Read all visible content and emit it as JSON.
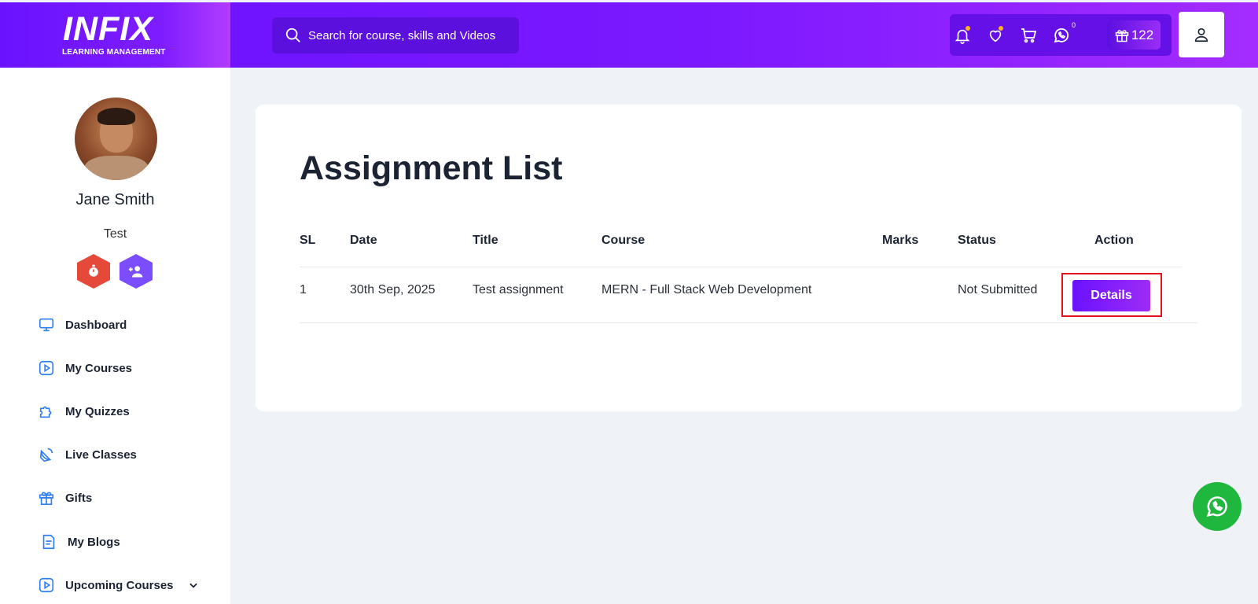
{
  "brand": {
    "logo": "INFIX",
    "tagline": "LEARNING MANAGEMENT"
  },
  "search": {
    "placeholder": "Search for course, skills and Videos"
  },
  "header_tools": {
    "whatsapp_count": "0",
    "points": "122",
    "icons": [
      "bell-icon",
      "heart-icon",
      "cart-icon",
      "whatsapp-icon",
      "gift-icon",
      "user-icon"
    ]
  },
  "profile": {
    "name": "Jane Smith",
    "role": "Test"
  },
  "sidebar": {
    "items": [
      {
        "label": "Dashboard",
        "icon": "monitor-icon"
      },
      {
        "label": "My Courses",
        "icon": "play-icon"
      },
      {
        "label": "My Quizzes",
        "icon": "puzzle-icon"
      },
      {
        "label": "Live Classes",
        "icon": "satellite-icon"
      },
      {
        "label": "Gifts",
        "icon": "gift-icon"
      },
      {
        "label": "My Blogs",
        "icon": "document-icon"
      },
      {
        "label": "Upcoming Courses",
        "icon": "play-icon"
      }
    ]
  },
  "main": {
    "title": "Assignment List",
    "columns": [
      "SL",
      "Date",
      "Title",
      "Course",
      "Marks",
      "Status",
      "Action"
    ],
    "rows": [
      {
        "sl": "1",
        "date": "30th Sep, 2025",
        "title": "Test assignment",
        "course": "MERN - Full Stack Web Development",
        "marks": "",
        "status": "Not Submitted",
        "action": "Details"
      }
    ]
  },
  "colors": {
    "primary": "#6a12ff",
    "accent_end": "#a42cff",
    "highlight": "#e8101c",
    "whatsapp": "#1fb73d"
  }
}
